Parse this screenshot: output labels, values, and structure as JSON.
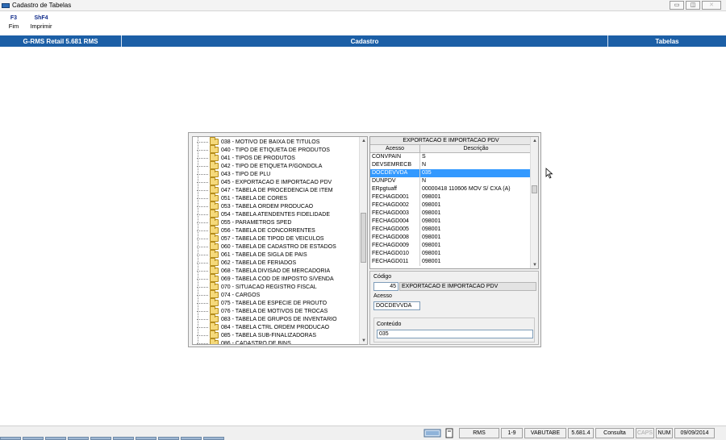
{
  "window": {
    "title": "Cadastro de Tabelas",
    "minimize_glyph": "▭",
    "restore_glyph": "◫",
    "close_glyph": "✕"
  },
  "function_keys": [
    {
      "key": "F3",
      "label": "Fim"
    },
    {
      "key": "ShF4",
      "label": "Imprimir"
    }
  ],
  "header": {
    "left": "G-RMS Retail 5.681 RMS",
    "center": "Cadastro",
    "right": "Tabelas"
  },
  "tree": {
    "items": [
      "038 - MOTIVO DE BAIXA DE TITULOS",
      "040 - TIPO DE ETIQUETA DE PRODUTOS",
      "041 - TIPOS DE PRODUTOS",
      "042 - TIPO DE ETIQUETA P/GONDOLA",
      "043 - TIPO DE PLU",
      "045 - EXPORTACAO E IMPORTACAO PDV",
      "047 - TABELA DE PROCEDENCIA DE ITEM",
      "051 - TABELA DE CORES",
      "053 - TABELA ORDEM PRODUCAO",
      "054 - TABELA ATENDENTES FIDELIDADE",
      "055 - PARAMETROS SPED",
      "056 - TABELA DE CONCORRENTES",
      "057 - TABELA DE TIPOD DE VEICULOS",
      "060 - TABELA DE CADASTRO DE ESTADOS",
      "061 - TABELA DE SIGLA DE PAIS",
      "062 - TABELA DE FERIADOS",
      "068 - TABELA  DIVISAO DE MERCADORIA",
      "069 - TABELA COD DE IMPOSTO S/VENDA",
      "070 - SITUACAO REGISTRO FISCAL",
      "074 - CARGOS",
      "075 - TABELA DE ESPECIE DE PROUTO",
      "076 - TABELA DE MOTIVOS DE TROCAS",
      "083 - TABELA DE GRUPOS DE INVENTARIO",
      "084 - TABELA CTRL ORDEM PRODUCAO",
      "085 - TABELA SUB-FINALIZADORAS",
      "086 - CADASTRO DE BINS"
    ]
  },
  "grid": {
    "title": "EXPORTACAO E IMPORTACAO PDV",
    "col_acesso": "Acesso",
    "col_descricao": "Descrição",
    "selected_index": 2,
    "rows": [
      {
        "acesso": "CONVPAIN",
        "descricao": "S"
      },
      {
        "acesso": "DEVSEMRECB",
        "descricao": "N"
      },
      {
        "acesso": "DOCDEVVDA",
        "descricao": "035"
      },
      {
        "acesso": "DUNPDV",
        "descricao": "N"
      },
      {
        "acesso": "ERpgtuaff",
        "descricao": "00000418 110606 MOV S/ CXA (A)"
      },
      {
        "acesso": "FECHAGD001",
        "descricao": "098001"
      },
      {
        "acesso": "FECHAGD002",
        "descricao": "098001"
      },
      {
        "acesso": "FECHAGD003",
        "descricao": "098001"
      },
      {
        "acesso": "FECHAGD004",
        "descricao": "098001"
      },
      {
        "acesso": "FECHAGD005",
        "descricao": "098001"
      },
      {
        "acesso": "FECHAGD008",
        "descricao": "098001"
      },
      {
        "acesso": "FECHAGD009",
        "descricao": "098001"
      },
      {
        "acesso": "FECHAGD010",
        "descricao": "098001"
      },
      {
        "acesso": "FECHAGD011",
        "descricao": "098001"
      }
    ]
  },
  "form": {
    "codigo_label": "Código",
    "codigo_value": "45",
    "codigo_desc": "EXPORTACAO E IMPORTACAO PDV",
    "acesso_label": "Acesso",
    "acesso_value": "DOCDEVVDA",
    "conteudo_label": "Conteúdo",
    "conteudo_value": "035"
  },
  "statusbar": {
    "rms": "RMS",
    "page": "1-9",
    "program": "VABUTABE",
    "version": "5.681.4",
    "mode": "Consulta",
    "caps": "CAPS",
    "num": "NUM",
    "date": "09/09/2014"
  }
}
